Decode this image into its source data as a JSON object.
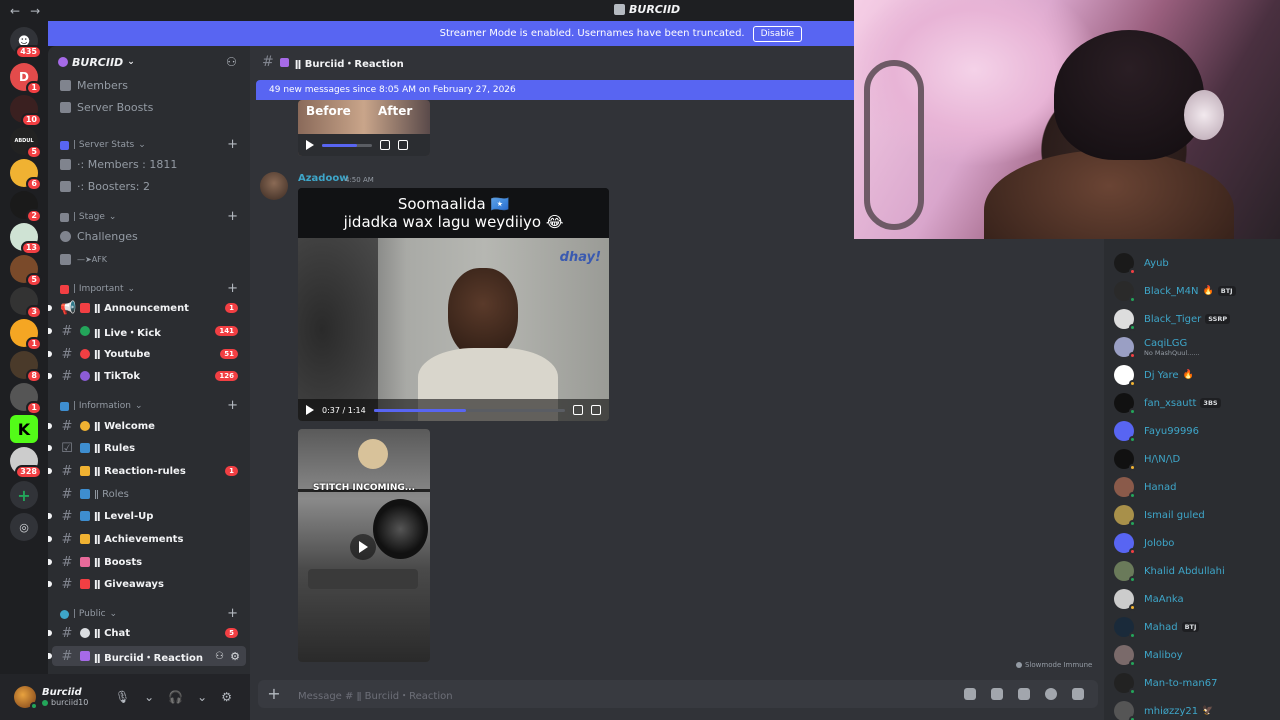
{
  "titlebar": {
    "title": "BURCIID",
    "back": "←",
    "forward": "→"
  },
  "streamer_banner": {
    "text": "Streamer Mode is enabled. Usernames have been truncated.",
    "button": "Disable"
  },
  "rail": {
    "dm_badge": "435",
    "servers": [
      {
        "badge": "1",
        "color": "#e34b4b",
        "glyph": "D"
      },
      {
        "badge": "10",
        "color": "#3a2020",
        "glyph": ""
      },
      {
        "badge": "5",
        "color": "#222222",
        "glyph": "ABDUL"
      },
      {
        "badge": "6",
        "color": "#f0b232",
        "glyph": ""
      },
      {
        "badge": "2",
        "color": "#1a1a1a",
        "glyph": ""
      },
      {
        "badge": "13",
        "color": "#cfe3d4",
        "glyph": ""
      },
      {
        "badge": "5",
        "color": "#7a4a2a",
        "glyph": ""
      },
      {
        "badge": "3",
        "color": "#333333",
        "glyph": ""
      },
      {
        "badge": "1",
        "color": "#f5a623",
        "glyph": ""
      },
      {
        "badge": "8",
        "color": "#4a3a2a",
        "glyph": ""
      },
      {
        "badge": "1",
        "color": "#555555",
        "glyph": ""
      },
      {
        "badge": "",
        "color": "#53fc18",
        "glyph": "K"
      },
      {
        "badge": "328",
        "color": "#cccccc",
        "glyph": ""
      }
    ]
  },
  "guild": {
    "name": "BURCIID"
  },
  "sidebar": {
    "members": "Members",
    "server_boosts": "Server Boosts",
    "cat_server_stats": "| Server Stats",
    "stat_members": "·: Members : 1811",
    "stat_boosters": "·: Boosters: 2",
    "cat_stage": "| Stage",
    "challenges": "Challenges",
    "afk": "—➤AFK",
    "cat_important": "| Important",
    "cat_information": "| Information",
    "cat_public": "| Public",
    "channels": {
      "announcement": {
        "name": "ǁ Announcement",
        "badge": "1"
      },
      "live_kick": {
        "name": "ǁ Live・Kick",
        "badge": "141"
      },
      "youtube": {
        "name": "ǁ Youtube",
        "badge": "51"
      },
      "tiktok": {
        "name": "ǁ TikTok",
        "badge": "126"
      },
      "welcome": {
        "name": "ǁ Welcome"
      },
      "rules": {
        "name": "ǁ Rules"
      },
      "reaction_rules": {
        "name": "ǁ Reaction-rules",
        "badge": "1"
      },
      "roles": {
        "name": "ǁ Roles"
      },
      "level_up": {
        "name": "ǁ Level-Up"
      },
      "achievements": {
        "name": "ǁ Achievements"
      },
      "boosts": {
        "name": "ǁ Boosts"
      },
      "giveaways": {
        "name": "ǁ Giveaways"
      },
      "chat": {
        "name": "ǁ Chat",
        "badge": "5"
      },
      "burciid_reaction": {
        "name": "ǁ Burciid・Reaction"
      }
    }
  },
  "user": {
    "name": "Burciid",
    "tag": "burciid10"
  },
  "channel_header": {
    "name": "ǁ Burciid・Reaction"
  },
  "new_messages": "49 new messages since 8:05 AM on February 27, 2026",
  "messages": {
    "top_video": {
      "before": "Before",
      "after": "After"
    },
    "author": "Azadoow",
    "time": "4:50 AM",
    "video1": {
      "caption_line1": "Soomaalida 🇸🇴",
      "caption_line2": "jidadka wax lagu weydiiyo 😂",
      "watermark": "dhay!",
      "time": "0:37 / 1:14",
      "progress": 0.48
    },
    "video2": {
      "caption": "STITCH INCOMING..."
    }
  },
  "slowmode": "Slowmode Immune",
  "composer": {
    "placeholder": "Message # ǁ Burciid・Reaction"
  },
  "members_list": [
    {
      "name": "Ayub",
      "status_color": "#f23f43",
      "avatar": "#1a1a1a"
    },
    {
      "name": "Black_M4N",
      "emoji": "🔥",
      "tag": "BTJ",
      "status_color": "#23a55a",
      "avatar": "#2a2a2a"
    },
    {
      "name": "Black_Tiger",
      "tag": "SSRP",
      "status_color": "#23a55a",
      "avatar": "#dddddd"
    },
    {
      "name": "CaqiLGG",
      "status": "No MashQuul......",
      "status_color": "#f23f43",
      "avatar": "#9a9fc4"
    },
    {
      "name": "Dj Yare",
      "emoji": "🔥",
      "status_color": "#f0b232",
      "avatar": "#ffffff"
    },
    {
      "name": "fan_xsautt",
      "tag": "3BS",
      "status_color": "#23a55a",
      "avatar": "#111111"
    },
    {
      "name": "Fayu99996",
      "status_color": "#23a55a",
      "avatar": "#5865f2"
    },
    {
      "name": "H/\\N/\\D",
      "status_color": "#f0b232",
      "avatar": "#111111"
    },
    {
      "name": "Hanad",
      "status_color": "#23a55a",
      "avatar": "#8a5a4a"
    },
    {
      "name": "Ismail guled",
      "status_color": "#23a55a",
      "avatar": "#a8904a"
    },
    {
      "name": "Jolobo",
      "status_color": "#f23f43",
      "avatar": "#5865f2"
    },
    {
      "name": "Khalid Abdullahi",
      "status_color": "#23a55a",
      "avatar": "#6a7a5a"
    },
    {
      "name": "MaAnka",
      "status_color": "#f0b232",
      "avatar": "#cccccc"
    },
    {
      "name": "Mahad",
      "tag": "BTJ",
      "status_color": "#23a55a",
      "avatar": "#1a2a3a"
    },
    {
      "name": "Maliboy",
      "status_color": "#23a55a",
      "avatar": "#7a6a6a"
    },
    {
      "name": "Man-to-man67",
      "status_color": "#23a55a",
      "avatar": "#222222"
    },
    {
      "name": "mhiøzzy21",
      "emoji": "🦅",
      "status_color": "#23a55a",
      "avatar": "#555555"
    }
  ]
}
